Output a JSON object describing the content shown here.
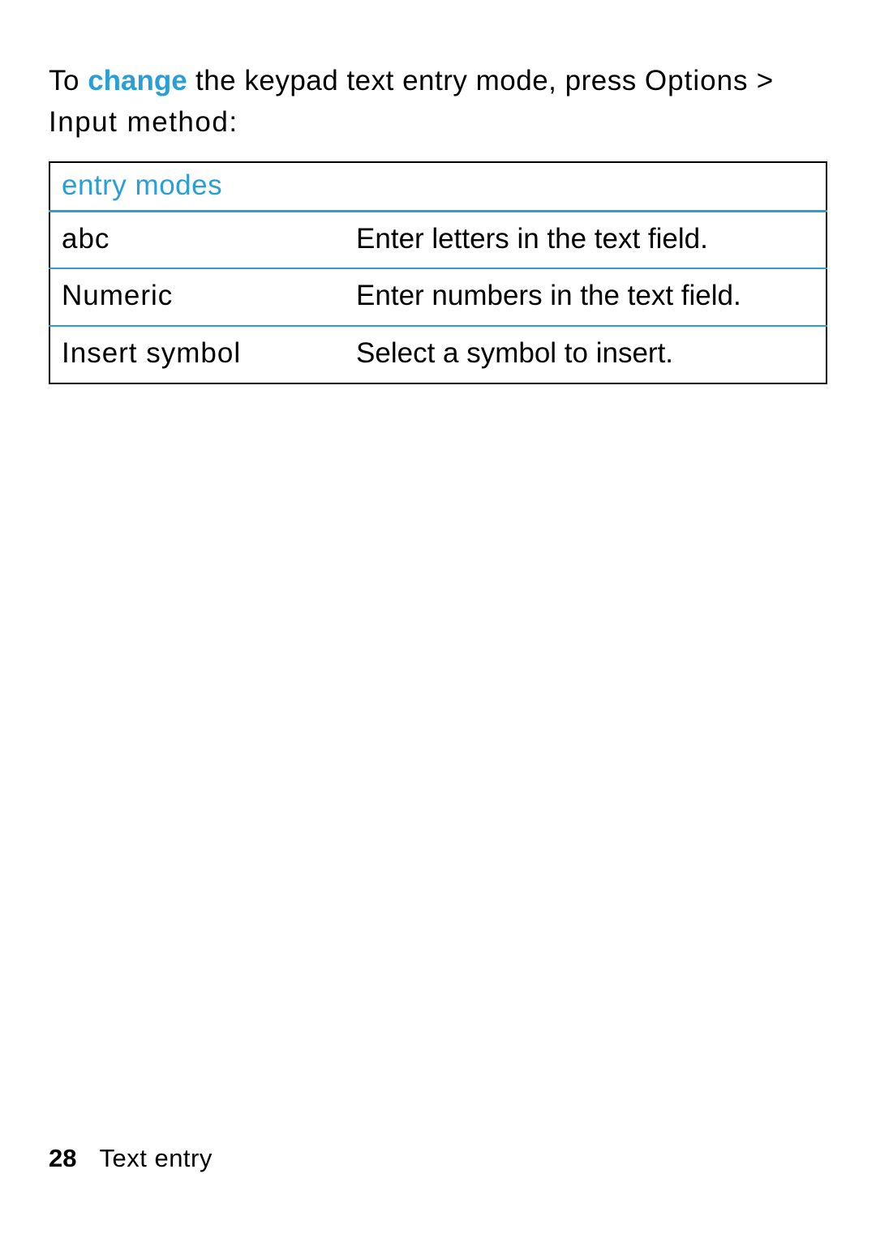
{
  "intro": {
    "part1": "To ",
    "change": "change",
    "part2": " the keypad text entry mode, press ",
    "options": "Options",
    "part3": " > ",
    "input_method": "Input method",
    "part4": ":"
  },
  "table": {
    "header": "entry modes",
    "rows": [
      {
        "mode": "abc",
        "desc": "Enter letters in the text field."
      },
      {
        "mode": "Numeric",
        "desc": "Enter numbers in the text field."
      },
      {
        "mode": "Insert symbol",
        "desc": "Select a symbol to insert."
      }
    ]
  },
  "footer": {
    "page": "28",
    "section": "Text entry"
  }
}
